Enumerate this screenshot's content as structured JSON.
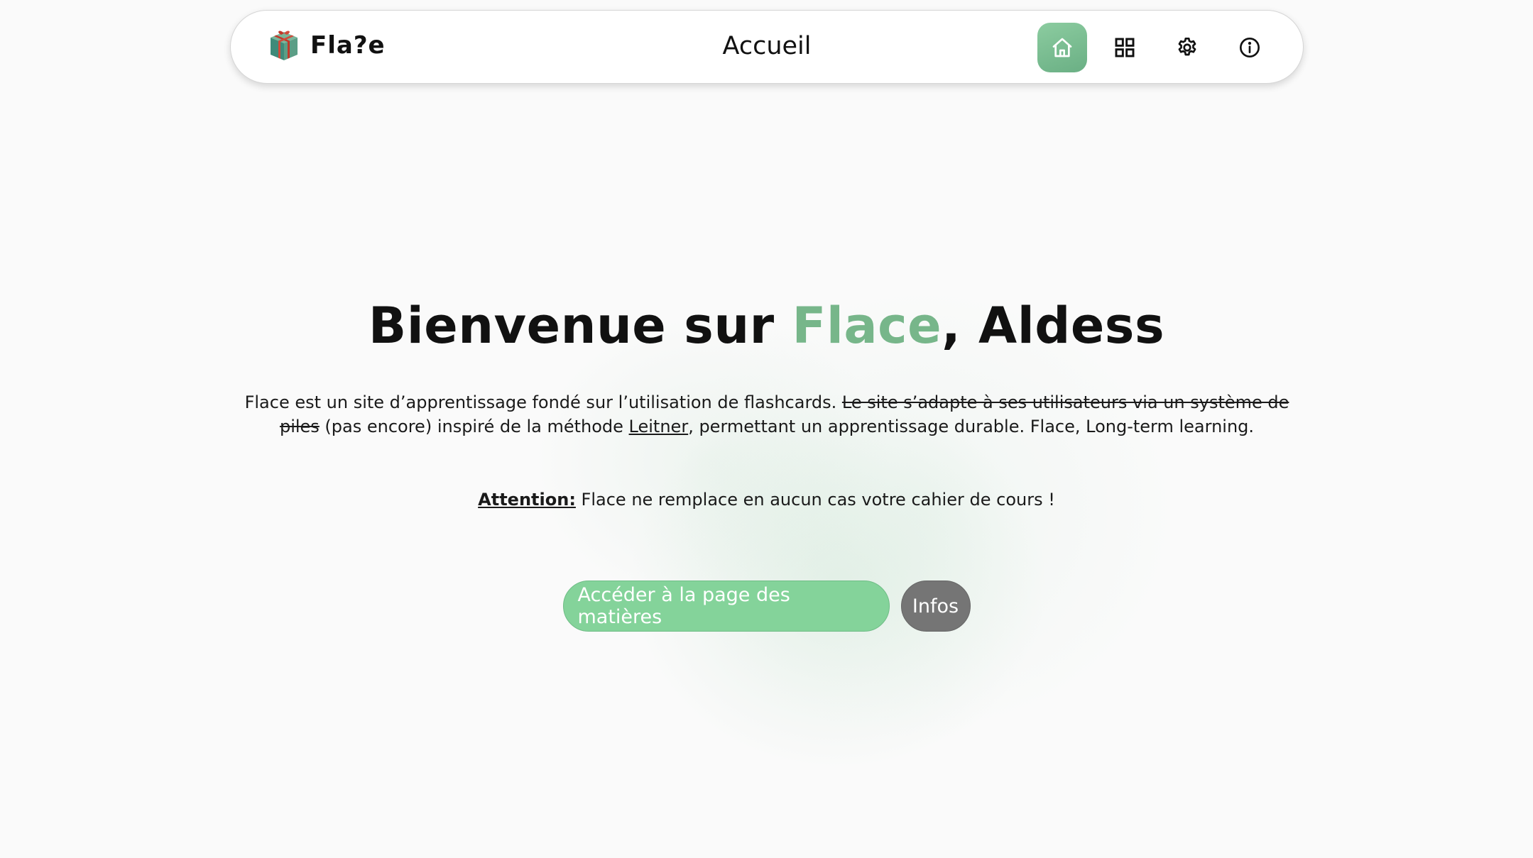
{
  "header": {
    "logo_text": "Fla?e",
    "page_title": "Accueil",
    "nav": [
      {
        "icon": "home-icon",
        "active": true
      },
      {
        "icon": "grid-icon",
        "active": false
      },
      {
        "icon": "gear-icon",
        "active": false
      },
      {
        "icon": "info-icon",
        "active": false
      }
    ]
  },
  "hero": {
    "title_prefix": "Bienvenue sur ",
    "title_brand": "Flace",
    "title_suffix": ", Aldess",
    "brand_color": "#77b68a"
  },
  "description": {
    "part1": "Flace est un site d’apprentissage fondé sur l’utilisation de flashcards. ",
    "strikethrough": "Le site s’adapte à ses utilisateurs via un système de piles",
    "part2": " (pas encore) inspiré de la méthode ",
    "link": "Leitner",
    "part3": ", permettant un apprentissage durable. Flace, Long-term learning."
  },
  "warning": {
    "label": "Attention:",
    "text": " Flace ne remplace en aucun cas votre cahier de cours !"
  },
  "buttons": {
    "primary_label": "Accéder à la page des matières",
    "secondary_label": "Infos",
    "primary_color": "#84d39a",
    "secondary_color": "#757575"
  }
}
